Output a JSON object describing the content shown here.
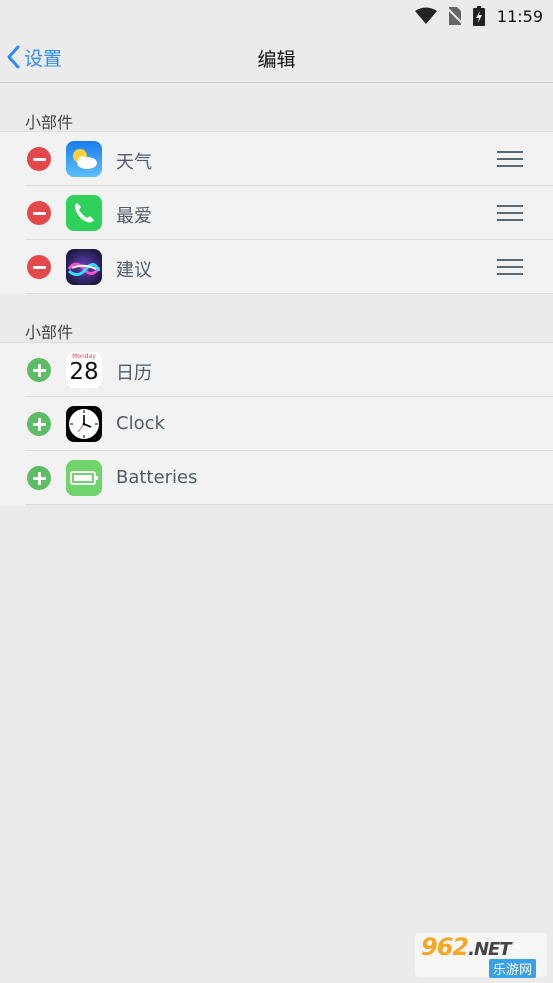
{
  "status_bar": {
    "time": "11:59"
  },
  "nav": {
    "back_label": "设置",
    "title": "编辑"
  },
  "sections": [
    {
      "header": "小部件",
      "items": [
        {
          "label": "天气",
          "action": "remove",
          "icon": "weather-icon"
        },
        {
          "label": "最爱",
          "action": "remove",
          "icon": "phone-icon"
        },
        {
          "label": "建议",
          "action": "remove",
          "icon": "siri-icon"
        }
      ]
    },
    {
      "header": "小部件",
      "items": [
        {
          "label": "日历",
          "action": "add",
          "icon": "calendar-icon",
          "calendar_day": "Monday",
          "calendar_date": "28"
        },
        {
          "label": "Clock",
          "action": "add",
          "icon": "clock-icon"
        },
        {
          "label": "Batteries",
          "action": "add",
          "icon": "battery-icon"
        }
      ]
    }
  ],
  "watermark": {
    "brand": "962",
    "suffix": ".NET",
    "site": "乐游网"
  },
  "colors": {
    "accent": "#2f8cf6",
    "remove": "#e5484a",
    "add": "#5cbd63"
  }
}
